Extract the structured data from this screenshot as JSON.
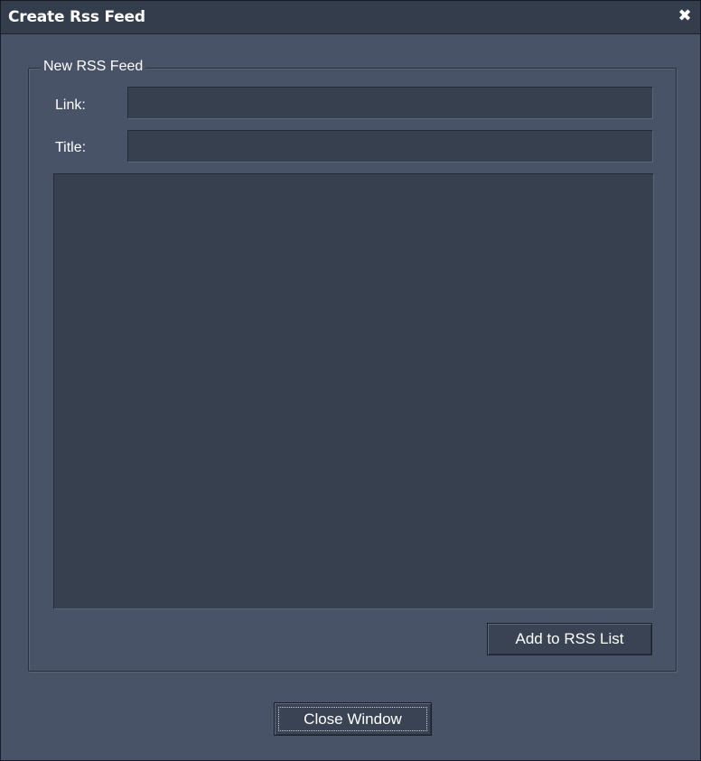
{
  "window": {
    "title": "Create Rss Feed",
    "close_glyph": "✖",
    "close_icon": "close-icon"
  },
  "group": {
    "legend": "New RSS Feed",
    "link_label": "Link:",
    "link_value": "",
    "title_label": "Title:",
    "title_value": "",
    "description_value": "",
    "add_button_label": "Add to RSS List"
  },
  "footer": {
    "close_button_label": "Close Window"
  },
  "colors": {
    "window_bg": "#485368",
    "titlebar_bg": "#333d4c",
    "field_bg": "#37404f",
    "text": "#ffffff"
  }
}
